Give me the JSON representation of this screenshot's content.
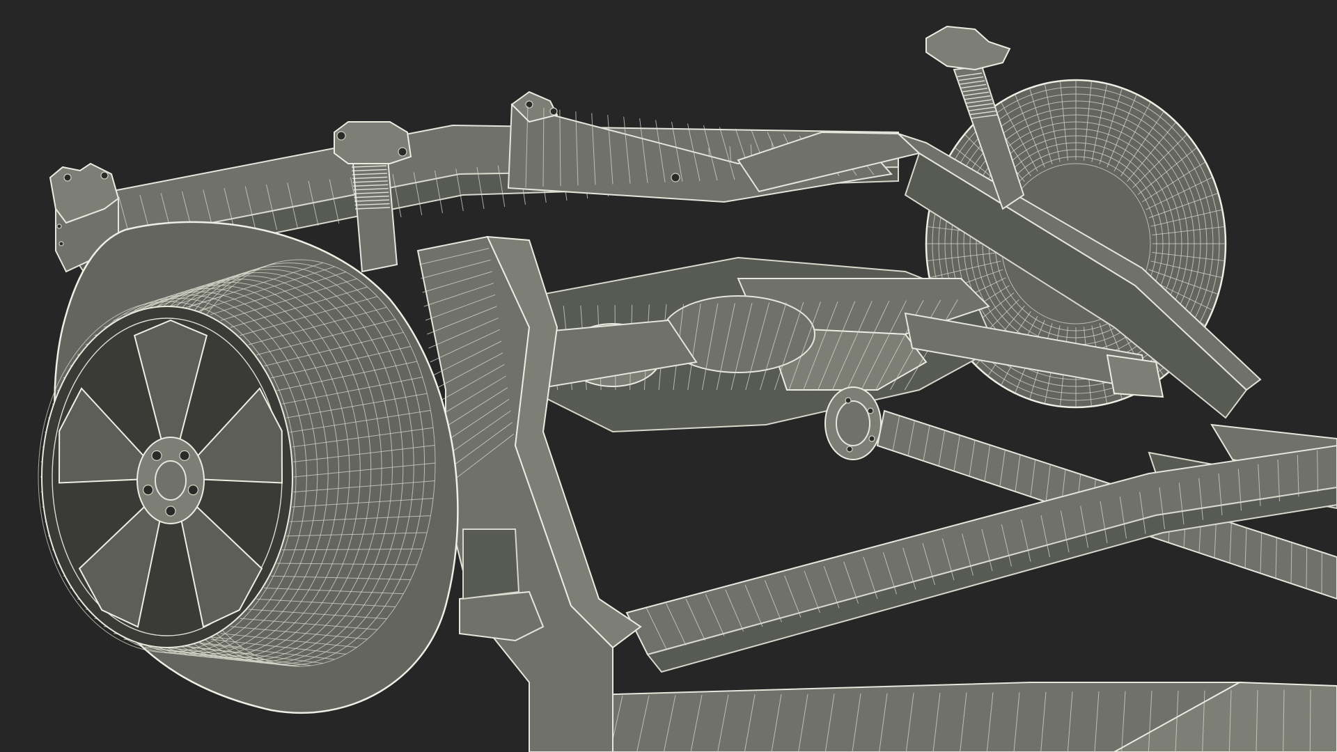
{
  "scene": {
    "background_color": "#262626",
    "mesh_fill_color": "#6f716a",
    "wireframe_color": "#e6e6dc"
  }
}
